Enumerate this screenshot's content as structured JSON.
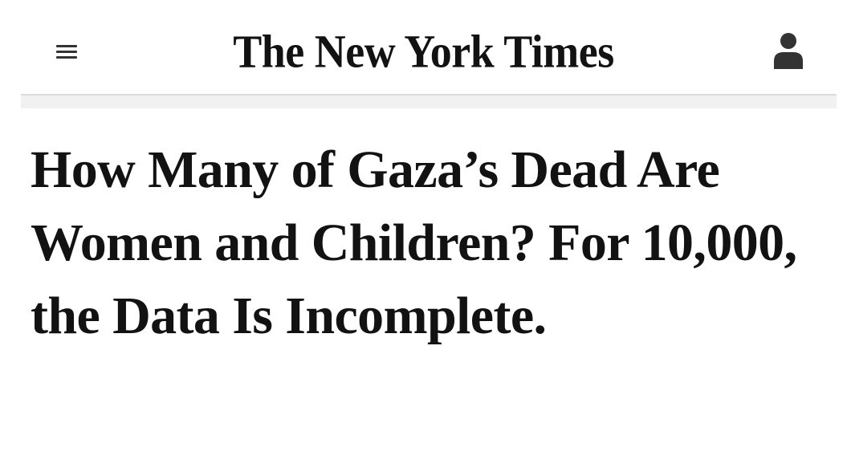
{
  "header": {
    "menu_icon": "hamburger-menu-icon",
    "masthead": "The New York Times",
    "account_icon": "user-account-icon"
  },
  "article": {
    "headline": "How Many of Gaza’s Dead Are Women and Children? For 10,000, the Data Is Incomplete."
  },
  "colors": {
    "text": "#121212",
    "divider": "#dcdcdc",
    "icon": "#333333",
    "background": "#ffffff"
  }
}
